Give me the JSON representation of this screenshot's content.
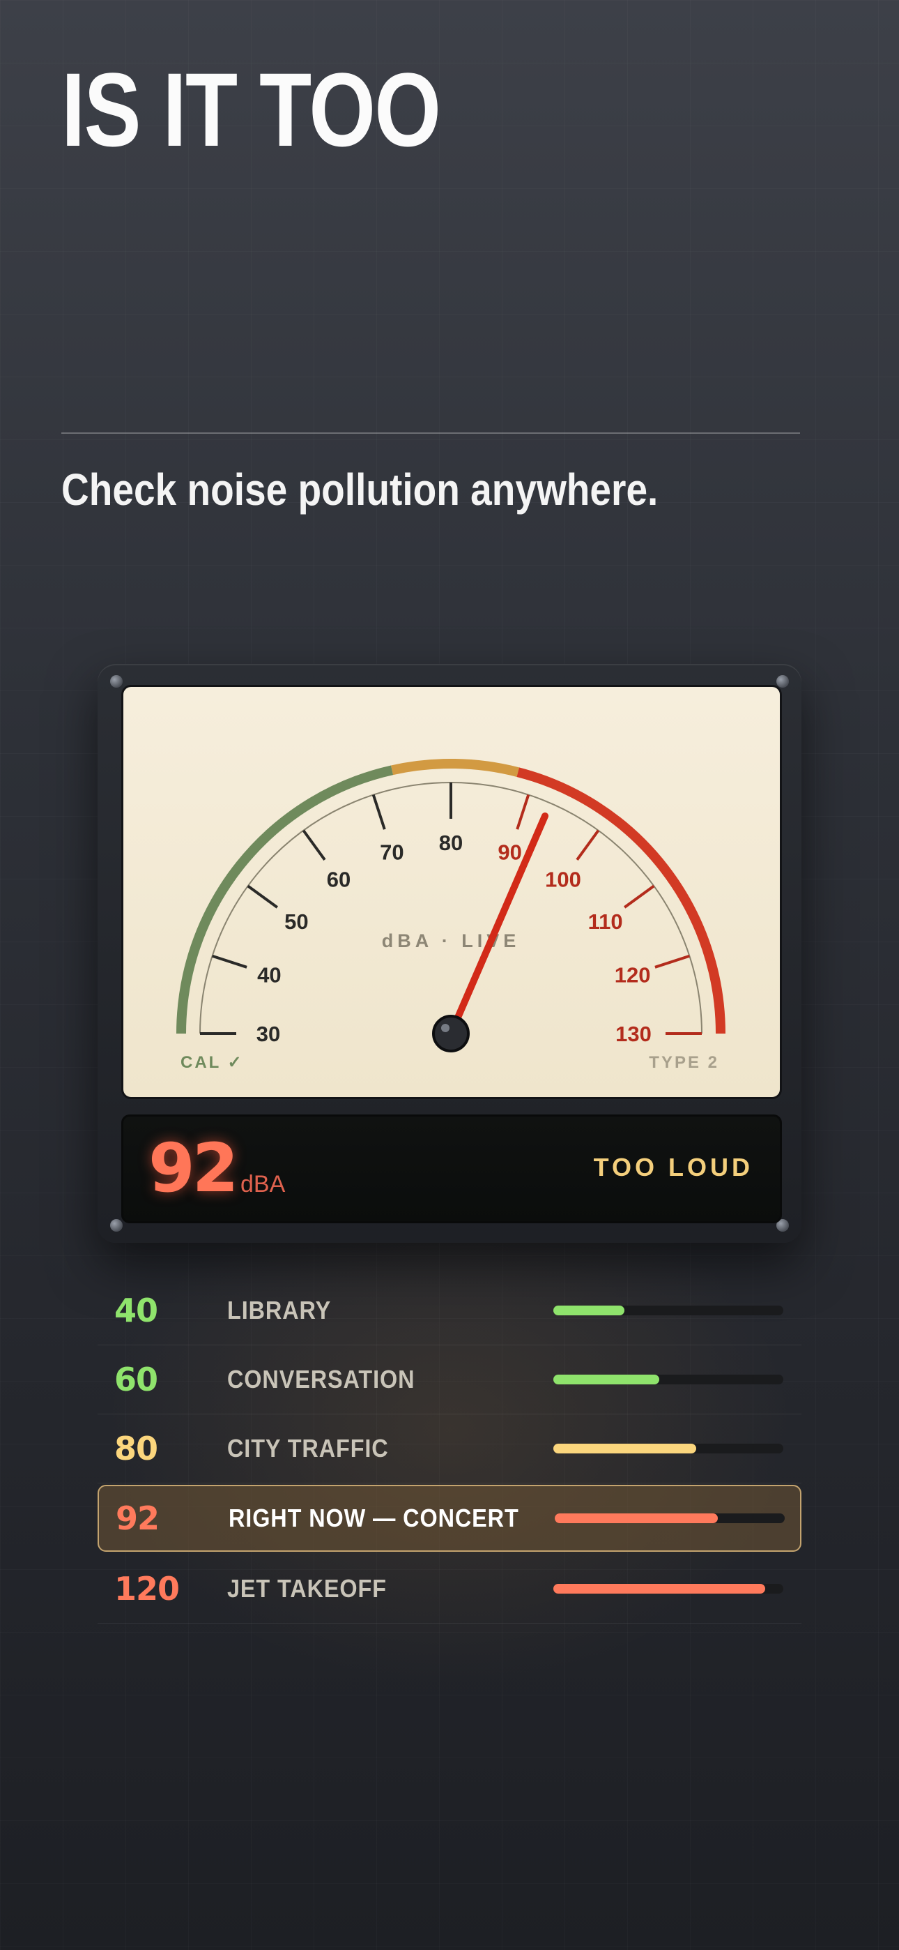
{
  "headline": "IS IT TOO",
  "subheadline": "Check noise pollution anywhere.",
  "meter": {
    "scale_label": "dBA · LIVE",
    "calibration": "CAL ✓",
    "meter_type": "TYPE 2",
    "min": 30,
    "max": 130,
    "needle_value": 93,
    "ticks": [
      30,
      40,
      50,
      60,
      70,
      80,
      90,
      100,
      110,
      120,
      130
    ],
    "zones": [
      {
        "from": 30,
        "to": 73,
        "color": "#6f8a5c"
      },
      {
        "from": 73,
        "to": 88,
        "color": "#d29a42"
      },
      {
        "from": 88,
        "to": 130,
        "color": "#d23a24"
      }
    ],
    "safe_tick_color": "#2a2a28",
    "loud_tick_color": "#b32c1c",
    "needle_color": "#d22a18"
  },
  "readout": {
    "value": "92",
    "unit": "dBA",
    "status": "TOO LOUD"
  },
  "levels": [
    {
      "value": "40",
      "label": "LIBRARY",
      "fraction": 0.31,
      "color": "#8fe36c",
      "highlight": false
    },
    {
      "value": "60",
      "label": "CONVERSATION",
      "fraction": 0.46,
      "color": "#8fe36c",
      "highlight": false
    },
    {
      "value": "80",
      "label": "CITY TRAFFIC",
      "fraction": 0.62,
      "color": "#fbd67d",
      "highlight": false
    },
    {
      "value": "92",
      "label": "RIGHT NOW — CONCERT",
      "fraction": 0.71,
      "color": "#ff7a5c",
      "highlight": true
    },
    {
      "value": "120",
      "label": "JET TAKEOFF",
      "fraction": 0.92,
      "color": "#ff7a5c",
      "highlight": false
    }
  ]
}
